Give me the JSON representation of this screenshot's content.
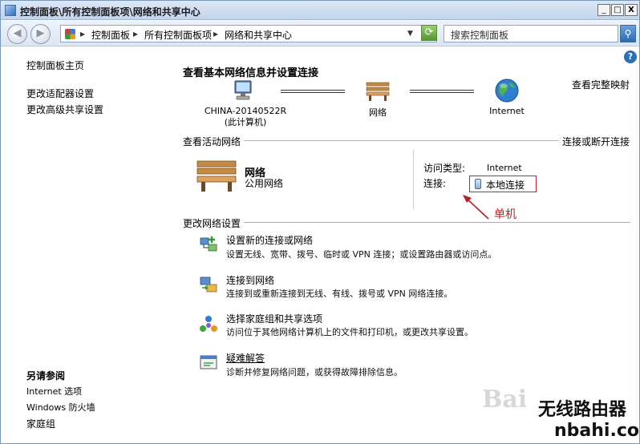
{
  "window": {
    "title": "控制面板\\所有控制面板项\\网络和共享中心",
    "minimize": "_",
    "maximize": "□",
    "close": "X"
  },
  "address": {
    "back": "◀",
    "forward": "▶",
    "crumbs": [
      "控制面板",
      "所有控制面板项",
      "网络和共享中心"
    ],
    "separator": "▸",
    "search_placeholder": "搜索控制面板"
  },
  "help": "?",
  "sidebar": {
    "home": "控制面板主页",
    "items": [
      "更改适配器设置",
      "更改高级共享设置"
    ],
    "see_also_title": "另请参阅",
    "see_also": [
      "Internet 选项",
      "Windows 防火墙",
      "家庭组"
    ]
  },
  "main": {
    "heading": "查看基本网络信息并设置连接",
    "view_full_map": "查看完整映射",
    "map": {
      "computer_name": "CHINA-20140522R",
      "computer_sub": "(此计算机)",
      "network": "网络",
      "internet": "Internet"
    },
    "active": {
      "title": "查看活动网络",
      "connect_link": "连接或断开连接",
      "network_name": "网络",
      "network_type": "公用网络",
      "access_type_label": "访问类型:",
      "access_type_value": "Internet",
      "connections_label": "连接:",
      "connection_link": "本地连接"
    },
    "annotation": "单机",
    "change": {
      "title": "更改网络设置",
      "tasks": [
        {
          "title": "设置新的连接或网络",
          "desc": "设置无线、宽带、拨号、临时或 VPN 连接；或设置路由器或访问点。",
          "icon": "new-connection-icon"
        },
        {
          "title": "连接到网络",
          "desc": "连接到或重新连接到无线、有线、拨号或 VPN 网络连接。",
          "icon": "connect-network-icon"
        },
        {
          "title": "选择家庭组和共享选项",
          "desc": "访问位于其他网络计算机上的文件和打印机，或更改共享设置。",
          "icon": "homegroup-icon"
        },
        {
          "title": "疑难解答",
          "desc": "诊断并修复网络问题，或获得故障排除信息。",
          "icon": "troubleshoot-icon"
        }
      ]
    }
  },
  "watermark": {
    "baidu": "Bai",
    "brand": "无线路由器",
    "site": "nbahi.com"
  }
}
